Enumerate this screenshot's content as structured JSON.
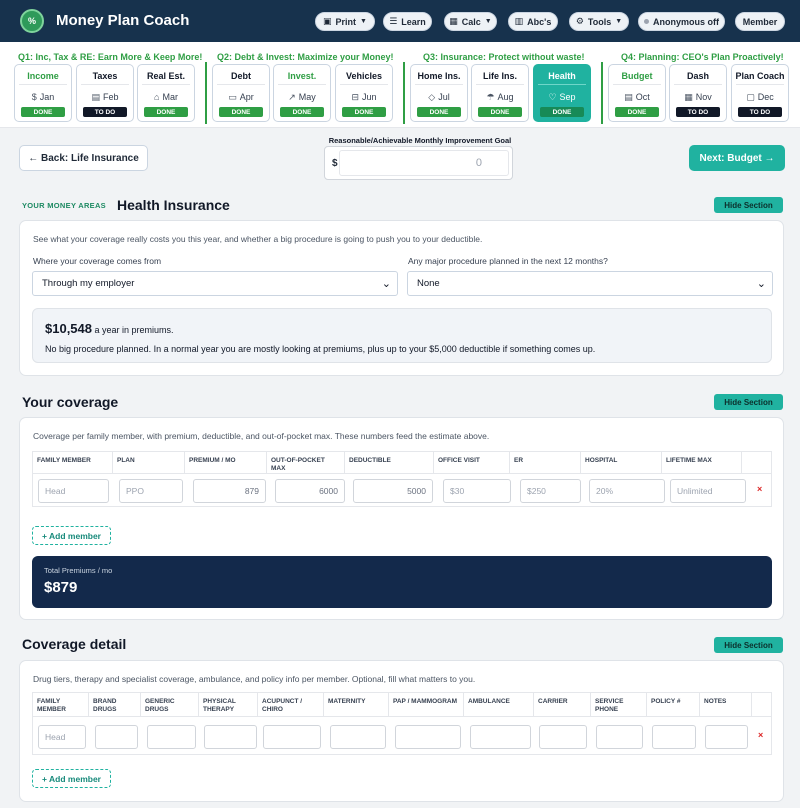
{
  "header": {
    "brand": "Money Plan Coach",
    "logo_text": "%",
    "nav": [
      {
        "label": "Print",
        "icon": "print-icon",
        "caret": true
      },
      {
        "label": "Learn",
        "icon": "list-icon",
        "caret": false
      },
      {
        "label": "Calc",
        "icon": "calculator-icon",
        "caret": true
      },
      {
        "label": "Abc's",
        "icon": "book-icon",
        "caret": false
      },
      {
        "label": "Tools",
        "icon": "gear-icon",
        "caret": true
      },
      {
        "label": "Anonymous off",
        "icon": "status-dot-icon",
        "caret": false
      },
      {
        "label": "Member",
        "icon": "",
        "caret": false
      }
    ]
  },
  "quarters": [
    {
      "title": "Q1: Inc, Tax & RE: Earn More & Keep More!"
    },
    {
      "title": "Q2: Debt & Invest: Maximize your Money!"
    },
    {
      "title": "Q3: Insurance: Protect without waste!"
    },
    {
      "title": "Q4: Planning: CEO's Plan Proactively!"
    }
  ],
  "months": [
    {
      "name": "Income",
      "month": "Jan",
      "status": "DONE",
      "green": true,
      "icon": "dollar-icon",
      "glyph": "$"
    },
    {
      "name": "Taxes",
      "month": "Feb",
      "status": "TO DO",
      "green": false,
      "icon": "receipt-icon",
      "glyph": "▤"
    },
    {
      "name": "Real Est.",
      "month": "Mar",
      "status": "DONE",
      "green": false,
      "icon": "house-icon",
      "glyph": "⌂"
    },
    {
      "name": "Debt",
      "month": "Apr",
      "status": "DONE",
      "green": false,
      "icon": "credit-card-icon",
      "glyph": "▭"
    },
    {
      "name": "Invest.",
      "month": "May",
      "status": "DONE",
      "green": true,
      "icon": "chart-line-icon",
      "glyph": "↗"
    },
    {
      "name": "Vehicles",
      "month": "Jun",
      "status": "DONE",
      "green": false,
      "icon": "car-icon",
      "glyph": "⊟"
    },
    {
      "name": "Home Ins.",
      "month": "Jul",
      "status": "DONE",
      "green": false,
      "icon": "shield-icon",
      "glyph": "◇"
    },
    {
      "name": "Life Ins.",
      "month": "Aug",
      "status": "DONE",
      "green": false,
      "icon": "umbrella-icon",
      "glyph": "☂"
    },
    {
      "name": "Health",
      "month": "Sep",
      "status": "DONE",
      "green": false,
      "icon": "heart-icon",
      "glyph": "♡",
      "active": true
    },
    {
      "name": "Budget",
      "month": "Oct",
      "status": "DONE",
      "green": true,
      "icon": "document-icon",
      "glyph": "▤"
    },
    {
      "name": "Dash",
      "month": "Nov",
      "status": "TO DO",
      "green": false,
      "icon": "grid-icon",
      "glyph": "▦"
    },
    {
      "name": "Plan Coach",
      "month": "Dec",
      "status": "TO DO",
      "green": false,
      "icon": "chat-icon",
      "glyph": "▢"
    }
  ],
  "actions": {
    "back_label": "← Back: Life Insurance",
    "goal_label": "Reasonable/Achievable Monthly Improvement Goal",
    "goal_currency": "$",
    "goal_value": "0",
    "next_label": "Next: Budget →"
  },
  "health": {
    "eyebrow": "YOUR MONEY AREAS",
    "title": "Health Insurance",
    "hide_label": "Hide Section",
    "description": "See what your coverage really costs you this year, and whether a big procedure is going to push you to your deductible.",
    "source_label": "Where your coverage comes from",
    "source_value": "Through my employer",
    "procedure_label": "Any major procedure planned in the next 12 months?",
    "procedure_value": "None",
    "summary_amount": "$10,548",
    "summary_suffix": " a year in premiums.",
    "summary_text": "No big procedure planned. In a normal year you are mostly looking at premiums, plus up to your $5,000 deductible if something comes up."
  },
  "coverage": {
    "title": "Your coverage",
    "hide_label": "Hide Section",
    "description": "Coverage per family member, with premium, deductible, and out-of-pocket max. These numbers feed the estimate above.",
    "columns": [
      "FAMILY MEMBER",
      "PLAN",
      "PREMIUM / MO",
      "OUT-OF-POCKET MAX",
      "DEDUCTIBLE",
      "OFFICE VISIT",
      "ER",
      "HOSPITAL",
      "LIFETIME MAX"
    ],
    "row": {
      "member": "Head",
      "plan": "PPO",
      "premium": "879",
      "oop": "6000",
      "deductible": "5000",
      "office": "$30",
      "er": "$250",
      "hospital": "20%",
      "lifetime": "Unlimited"
    },
    "delete_label": "×",
    "add_label": "+ Add member",
    "total_label": "Total Premiums / mo",
    "total_value": "$879"
  },
  "detail": {
    "title": "Coverage detail",
    "hide_label": "Hide Section",
    "description": "Drug tiers, therapy and specialist coverage, ambulance, and policy info per member. Optional, fill what matters to you.",
    "columns": [
      "FAMILY MEMBER",
      "BRAND DRUGS",
      "GENERIC DRUGS",
      "PHYSICAL THERAPY",
      "ACUPUNCT / CHIRO",
      "MATERNITY",
      "PAP / MAMMOGRAM",
      "AMBULANCE",
      "CARRIER",
      "SERVICE PHONE",
      "POLICY #",
      "NOTES"
    ],
    "row_member": "Head",
    "delete_label": "×",
    "add_label": "+ Add member"
  },
  "colors": {
    "navy": "#17324d",
    "teal": "#20b2a0",
    "green": "#2f9e44",
    "dark": "#13294b"
  }
}
